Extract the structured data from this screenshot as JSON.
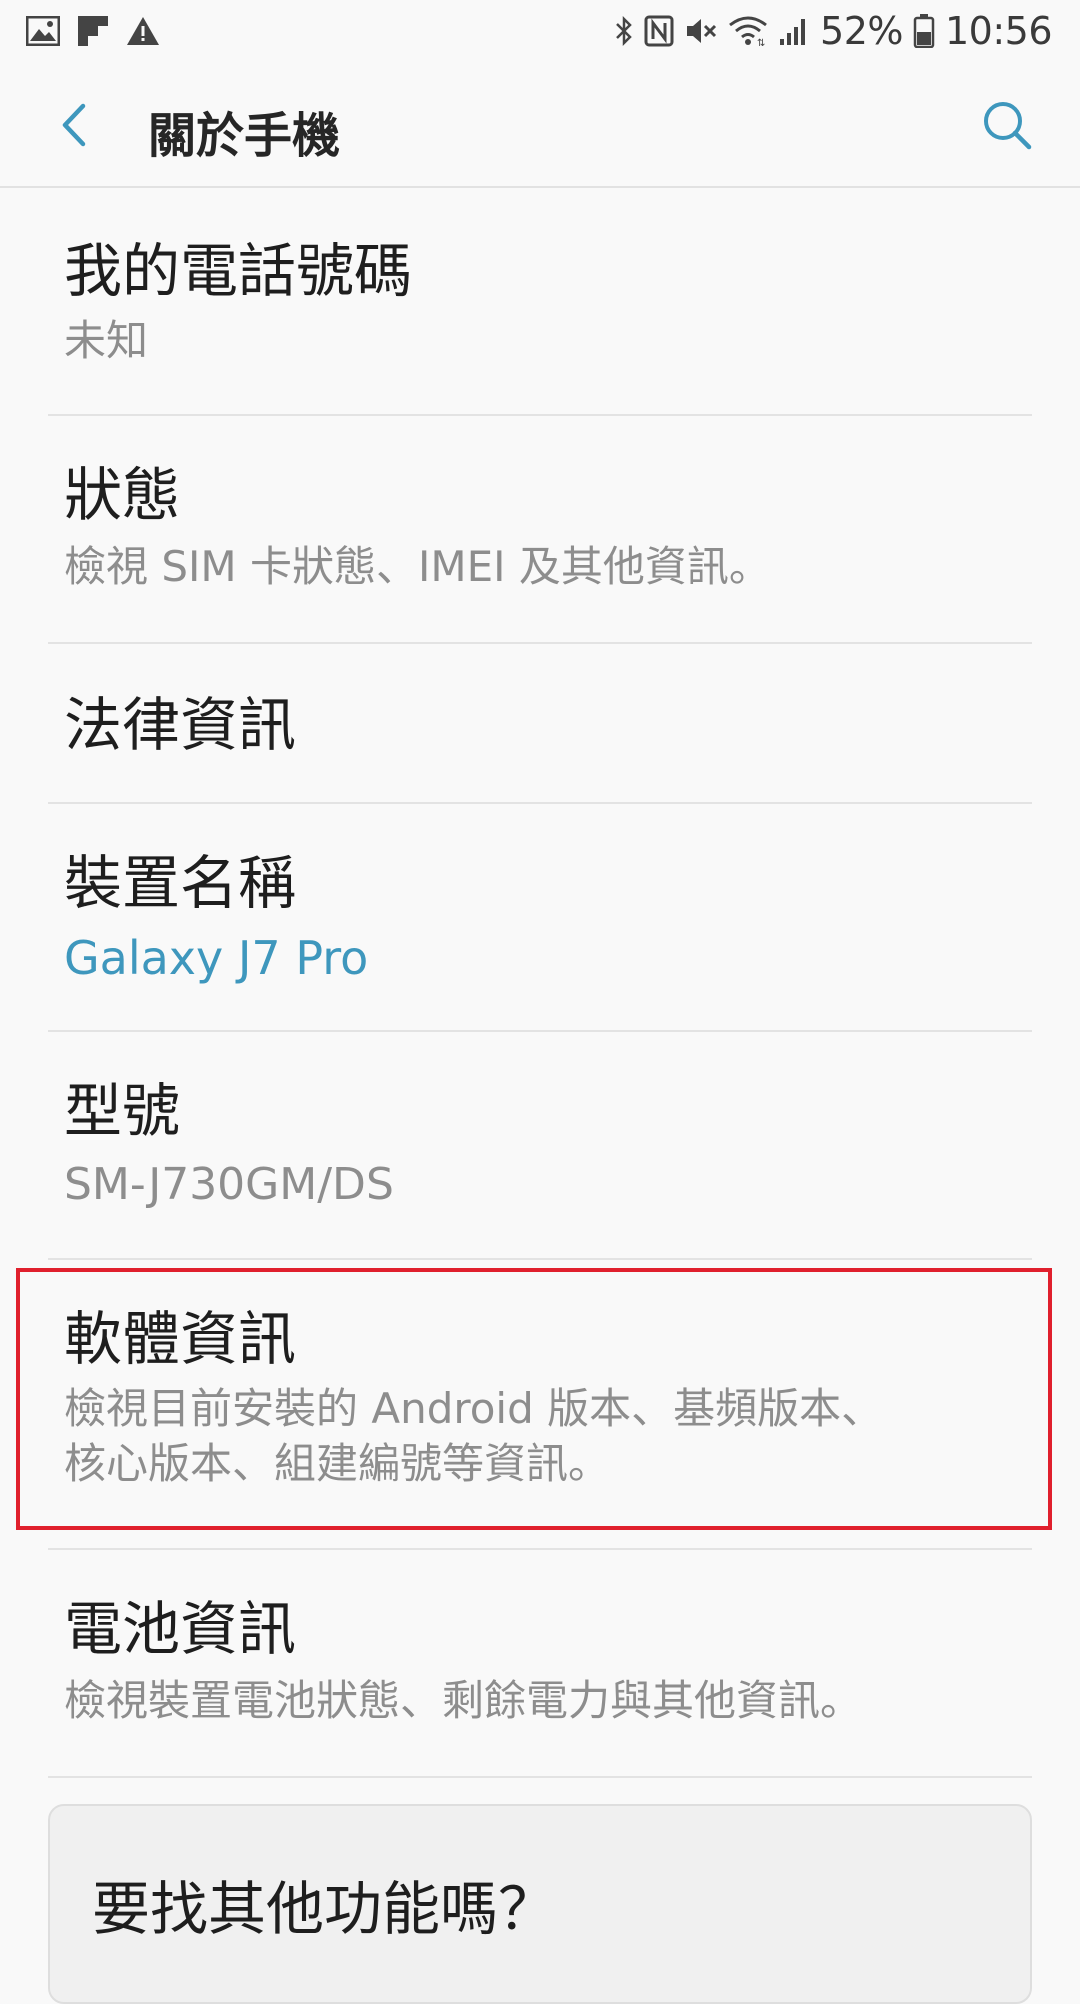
{
  "status_bar": {
    "battery": "52%",
    "time": "10:56",
    "left_icons": [
      "image-notification-icon",
      "flipboard-notification-icon",
      "warning-icon"
    ],
    "right_icons": [
      "bluetooth-icon",
      "nfc-icon",
      "mute-icon",
      "wifi-icon",
      "signal-icon",
      "battery-icon"
    ]
  },
  "header": {
    "title": "關於手機",
    "back_icon": "chevron-left-icon",
    "search_icon": "search-icon",
    "accent_color": "#3e97bd"
  },
  "items": [
    {
      "title": "我的電話號碼",
      "subtitle": "未知"
    },
    {
      "title": "狀態",
      "subtitle": "檢視 SIM 卡狀態、IMEI 及其他資訊。"
    },
    {
      "title": "法律資訊"
    },
    {
      "title": "裝置名稱",
      "subtitle": "Galaxy J7 Pro"
    },
    {
      "title": "型號",
      "subtitle": "SM-J730GM/DS"
    },
    {
      "title": "軟體資訊",
      "subtitle": "檢視目前安裝的 Android 版本、基頻版本、",
      "subtitle2": "核心版本、組建編號等資訊。"
    },
    {
      "title": "電池資訊",
      "subtitle": "檢視裝置電池狀態、剩餘電力與其他資訊。"
    }
  ],
  "suggestion": {
    "title": "要找其他功能嗎？"
  },
  "highlight_color": "#e0202d"
}
